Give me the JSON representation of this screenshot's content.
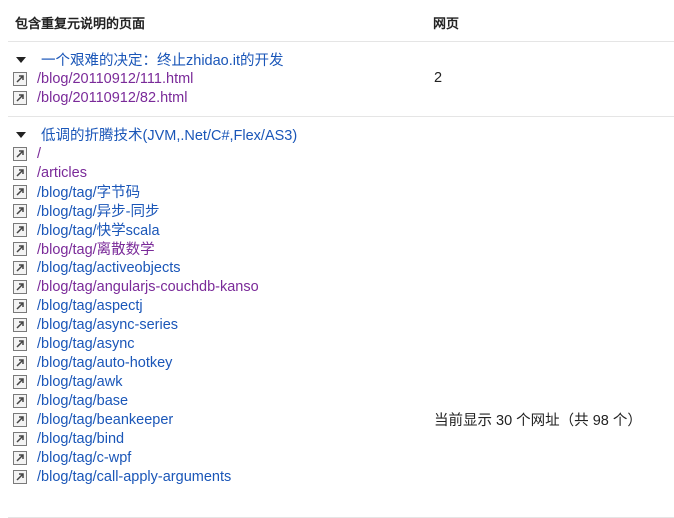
{
  "headers": {
    "description": "包含重复元说明的页面",
    "pages": "网页"
  },
  "groups": [
    {
      "title": "一个艰难的决定：终止zhidao.it的开发",
      "pages": "2",
      "links": [
        {
          "text": "/blog/20110912/111.html",
          "visited": true
        },
        {
          "text": "/blog/20110912/82.html",
          "visited": true
        }
      ]
    },
    {
      "title": "低调的折腾技术(JVM,.Net/C#,Flex/AS3)",
      "pages": "当前显示 30 个网址（共 98 个）",
      "links": [
        {
          "text": "/",
          "visited": true
        },
        {
          "text": "/articles",
          "visited": true
        },
        {
          "text": "/blog/tag/字节码",
          "visited": false
        },
        {
          "text": "/blog/tag/异步-同步",
          "visited": false
        },
        {
          "text": "/blog/tag/快学scala",
          "visited": false
        },
        {
          "text": "/blog/tag/离散数学",
          "visited": true
        },
        {
          "text": "/blog/tag/activeobjects",
          "visited": false
        },
        {
          "text": "/blog/tag/angularjs-couchdb-kanso",
          "visited": true
        },
        {
          "text": "/blog/tag/aspectj",
          "visited": false
        },
        {
          "text": "/blog/tag/async-series",
          "visited": false
        },
        {
          "text": "/blog/tag/async",
          "visited": false
        },
        {
          "text": "/blog/tag/auto-hotkey",
          "visited": false
        },
        {
          "text": "/blog/tag/awk",
          "visited": false
        },
        {
          "text": "/blog/tag/base",
          "visited": false
        },
        {
          "text": "/blog/tag/beankeeper",
          "visited": false
        },
        {
          "text": "/blog/tag/bind",
          "visited": false
        },
        {
          "text": "/blog/tag/c-wpf",
          "visited": false
        },
        {
          "text": "/blog/tag/call-apply-arguments",
          "visited": false
        }
      ]
    }
  ],
  "icons": {
    "group_toggle": "triangle-down-icon",
    "link_icon": "external-link-icon"
  },
  "colors": {
    "link": "#1a56b8",
    "visited_link": "#7a2a99",
    "divider": "#e5e5e5"
  }
}
